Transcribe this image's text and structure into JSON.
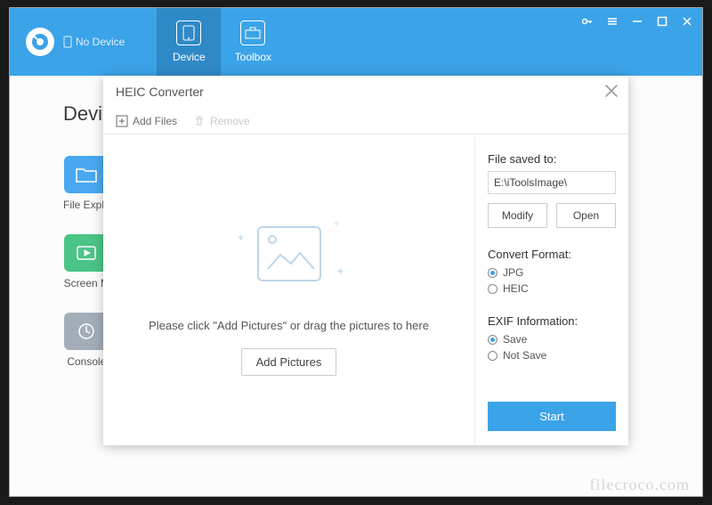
{
  "titlebar": {
    "device_status": "No Device",
    "tabs": {
      "device": "Device",
      "toolbox": "Toolbox"
    }
  },
  "page": {
    "title": "Device"
  },
  "tools": {
    "file_explorer": "File Explo",
    "screen_mirror": "Screen M",
    "console": "Console"
  },
  "modal": {
    "title": "HEIC Converter",
    "toolbar": {
      "add_files": "Add Files",
      "remove": "Remove"
    },
    "drop": {
      "hint": "Please click \"Add Pictures\" or drag the pictures to here",
      "add_button": "Add Pictures"
    },
    "side": {
      "saved_label": "File saved to:",
      "saved_path": "E:\\iToolsImage\\",
      "modify": "Modify",
      "open": "Open",
      "format_label": "Convert Format:",
      "format_jpg": "JPG",
      "format_heic": "HEIC",
      "exif_label": "EXIF Information:",
      "exif_save": "Save",
      "exif_not_save": "Not Save",
      "start": "Start"
    }
  },
  "watermark": "filecroco.com"
}
